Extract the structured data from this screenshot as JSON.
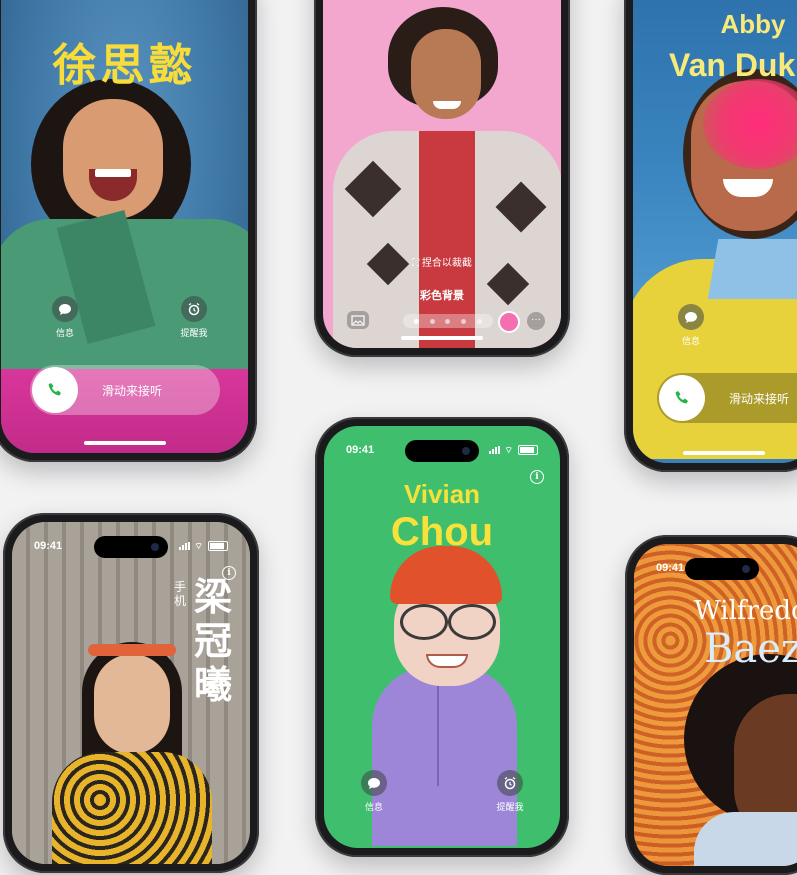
{
  "phones": {
    "p1": {
      "contact_name": "徐思懿",
      "message_label": "信息",
      "reminder_label": "提醒我",
      "slide_label": "滑动来接听"
    },
    "p2": {
      "crop_hint": "捏合以裁截",
      "bg_label": "彩色背景"
    },
    "p3": {
      "first_name": "Abby",
      "last_name": "Van Duk",
      "message_label": "信息",
      "slide_label": "滑动来接听"
    },
    "p4": {
      "time": "09:41",
      "label_small": "手机",
      "contact_name": "梁冠曦"
    },
    "p5": {
      "time": "09:41",
      "first_name": "Vivian",
      "last_name": "Chou",
      "message_label": "信息",
      "reminder_label": "提醒我"
    },
    "p6": {
      "time": "09:41",
      "first_name": "Wilfredo",
      "last_name": "Baez"
    }
  },
  "colors": {
    "page_bg": "#f2f2f3",
    "accent_yellow": "#f7dc3a",
    "call_green": "#26b34b",
    "pink_bg": "#f3a7cf",
    "green_bg": "#3fbf6e"
  }
}
